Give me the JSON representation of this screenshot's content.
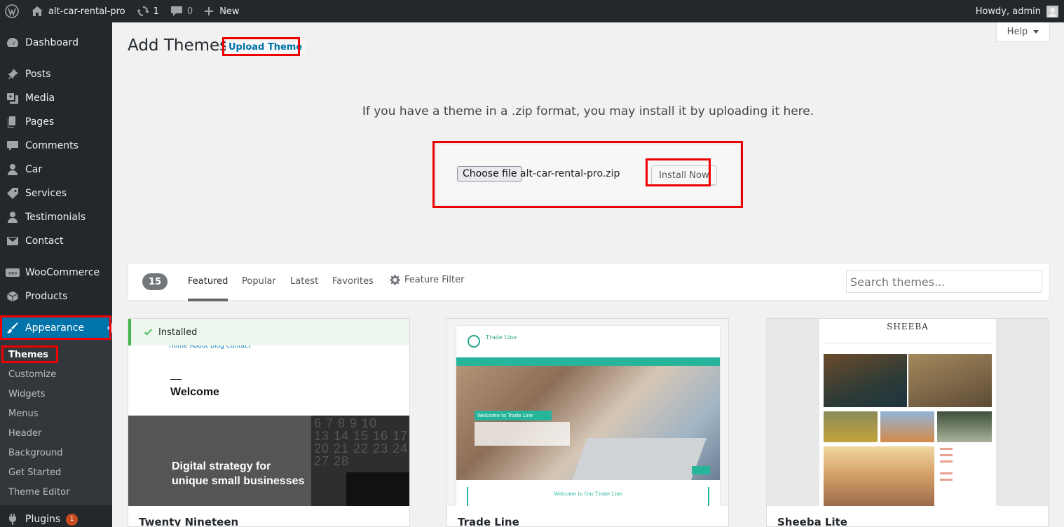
{
  "admin_bar": {
    "site_name": "alt-car-rental-pro",
    "updates_count": "1",
    "comments_count": "0",
    "new_label": "New",
    "howdy": "Howdy, admin"
  },
  "sidebar": {
    "items": [
      {
        "label": "Dashboard",
        "icon": "dashboard-icon"
      },
      {
        "label": "Posts",
        "icon": "pin-icon"
      },
      {
        "label": "Media",
        "icon": "media-icon"
      },
      {
        "label": "Pages",
        "icon": "pages-icon"
      },
      {
        "label": "Comments",
        "icon": "comment-icon"
      },
      {
        "label": "Car",
        "icon": "user-icon"
      },
      {
        "label": "Services",
        "icon": "tag-icon"
      },
      {
        "label": "Testimonials",
        "icon": "user-icon"
      },
      {
        "label": "Contact",
        "icon": "envelope-icon"
      },
      {
        "label": "WooCommerce",
        "icon": "woo-icon"
      },
      {
        "label": "Products",
        "icon": "box-icon"
      },
      {
        "label": "Appearance",
        "icon": "paintbrush-icon"
      },
      {
        "label": "Plugins",
        "icon": "plug-icon",
        "badge": "1"
      }
    ],
    "submenu": [
      "Themes",
      "Customize",
      "Widgets",
      "Menus",
      "Header",
      "Background",
      "Get Started",
      "Theme Editor"
    ]
  },
  "main": {
    "help_label": "Help",
    "title": "Add Themes",
    "upload_button": "Upload Theme",
    "upload_help": "If you have a theme in a .zip format, you may install it by uploading it here.",
    "choose_file": "Choose file",
    "file_name": "alt-car-rental-pro.zip",
    "install_now": "Install Now"
  },
  "filter": {
    "count": "15",
    "tabs": [
      "Featured",
      "Popular",
      "Latest",
      "Favorites"
    ],
    "feature_filter": "Feature Filter",
    "search_placeholder": "Search themes..."
  },
  "themes": [
    {
      "name": "Twenty Nineteen",
      "installed_label": "Installed",
      "preview_nav": "Home  About  Blog  Contact",
      "preview_welcome": "Welcome",
      "preview_hero": [
        "Digital strategy for",
        "unique small businesses"
      ],
      "preview_calendar": "6 7 8 9 10\n13 14 15 16 17\n20 21 22 23 24\n27 28"
    },
    {
      "name": "Trade Line",
      "preview_title": "Trade Line",
      "preview_caption": "Welcome to Trade Line",
      "preview_footer": "Welcome to Our Trade Line"
    },
    {
      "name": "Sheeba Lite",
      "preview_title": "SHEEBA"
    }
  ],
  "colors": {
    "admin_dark": "#23282d",
    "accent": "#0073aa",
    "highlight_box": "#e00000",
    "installed_green": "#46b450"
  }
}
